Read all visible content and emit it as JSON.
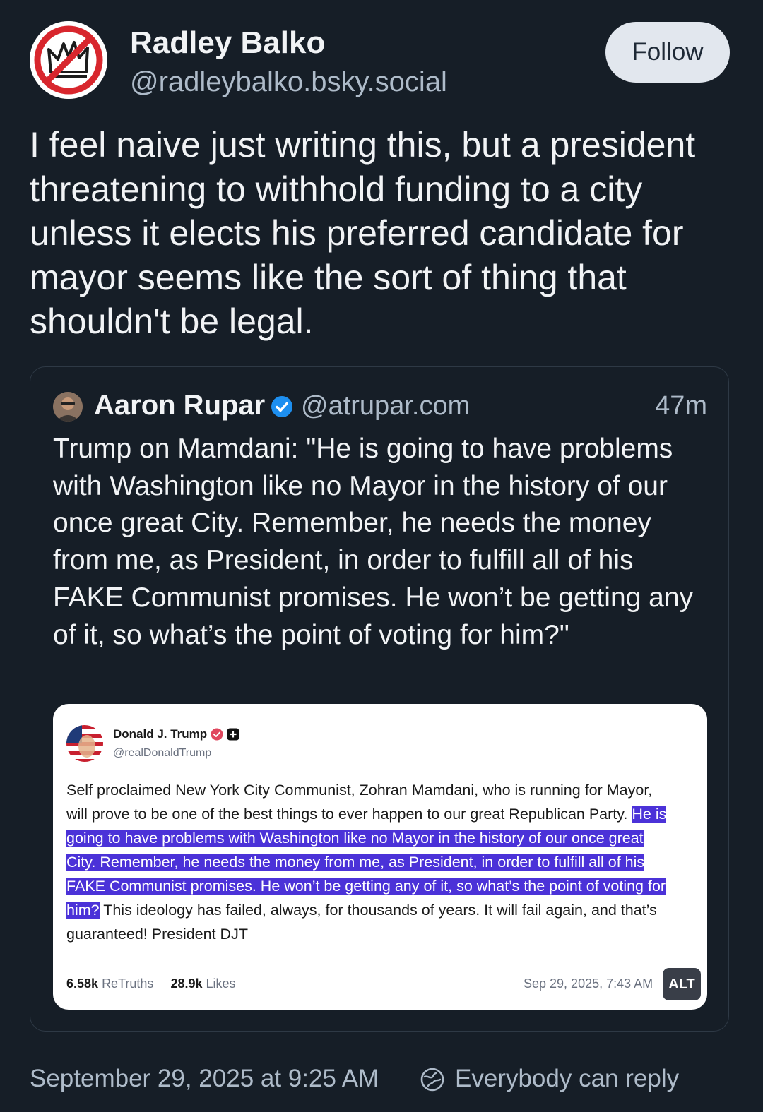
{
  "post": {
    "author_name": "Radley Balko",
    "author_handle": "@radleybalko.bsky.social",
    "follow_label": "Follow",
    "text": "I feel naive just writing this, but a president threatening to withhold funding to a city unless it elects his preferred candidate for mayor seems like the sort of thing that shouldn't be legal.",
    "timestamp": "September 29, 2025 at 9:25 AM",
    "reply_setting": "Everybody can reply"
  },
  "quote": {
    "author_name": "Aaron Rupar",
    "author_handle": "@atrupar.com",
    "time_ago": "47m",
    "text": "Trump on Mamdani: \"He is going to have problems with Washington like no Mayor in the history of our once great City. Remember, he needs the money from me, as President, in order to fulfill all of his FAKE Communist promises. He won’t be getting any of it, so what’s the point of voting for him?\""
  },
  "embed": {
    "author_name": "Donald J. Trump",
    "author_handle": "@realDonaldTrump",
    "body_before": "Self proclaimed New York City Communist, Zohran Mamdani, who is running for Mayor, will prove to be one of the best things to ever happen to our great Republican Party.",
    "body_highlight": "He is going to have problems with Washington like no Mayor in the history of our once great City. Remember, he needs the money from me, as President, in order to fulfill all of his FAKE Communist promises. He won’t be getting any of it, so what’s the point of voting for him?",
    "body_after": "This ideology has failed, always, for thousands of years. It will fail again, and that’s guaranteed!  President DJT",
    "retruths_count": "6.58k",
    "retruths_label": "ReTruths",
    "likes_count": "28.9k",
    "likes_label": "Likes",
    "date": "Sep 29, 2025, 7:43 AM",
    "alt_label": "ALT",
    "highlight_color": "#4b32d8"
  },
  "icons": {
    "main_avatar": "no-crown-icon",
    "verified": "verified-check-icon",
    "globe": "globe-icon"
  },
  "colors": {
    "background": "#161e27",
    "primary_text": "#f1f3f5",
    "secondary_text": "#aebbc9",
    "verified_blue": "#1d8ff0",
    "follow_button_bg": "#e2e7ee"
  }
}
